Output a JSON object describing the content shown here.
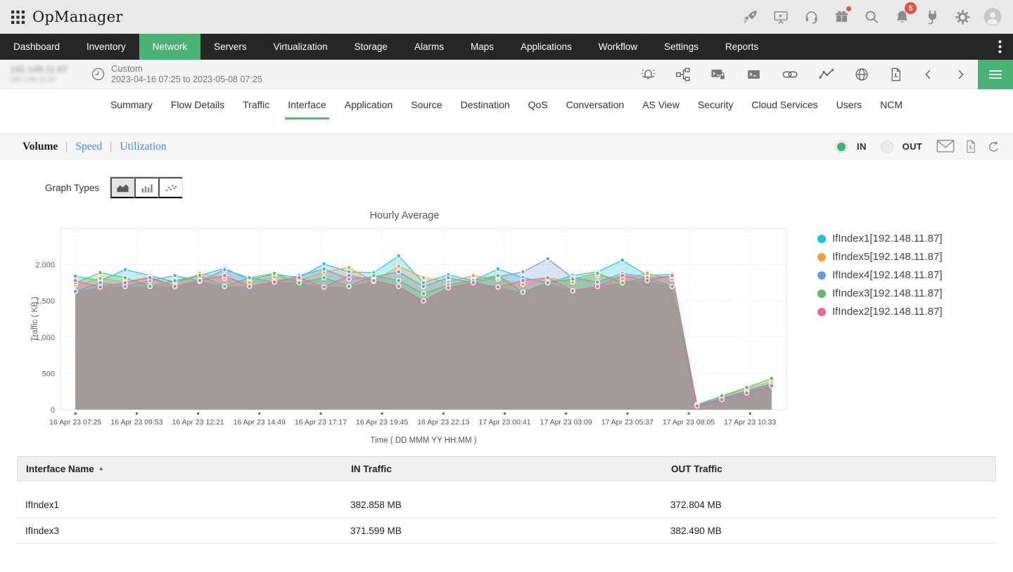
{
  "topbar": {
    "title": "OpManager",
    "icons": [
      {
        "name": "rocket-icon"
      },
      {
        "name": "demo-video-icon"
      },
      {
        "name": "support-headset-icon"
      },
      {
        "name": "whats-new-gift-icon",
        "dot": true
      },
      {
        "name": "search-icon"
      },
      {
        "name": "notifications-bell-icon",
        "badge": "5"
      },
      {
        "name": "integrations-plug-icon"
      },
      {
        "name": "settings-gear-icon"
      },
      {
        "name": "user-avatar"
      }
    ]
  },
  "nav": {
    "items": [
      {
        "label": "Dashboard",
        "active": false
      },
      {
        "label": "Inventory",
        "active": false
      },
      {
        "label": "Network",
        "active": true
      },
      {
        "label": "Servers",
        "active": false
      },
      {
        "label": "Virtualization",
        "active": false
      },
      {
        "label": "Storage",
        "active": false
      },
      {
        "label": "Alarms",
        "active": false
      },
      {
        "label": "Maps",
        "active": false
      },
      {
        "label": "Applications",
        "active": false
      },
      {
        "label": "Workflow",
        "active": false
      },
      {
        "label": "Settings",
        "active": false
      },
      {
        "label": "Reports",
        "active": false
      }
    ]
  },
  "subheader": {
    "device_name": "192.148.11.87",
    "device_name_line2": "192.148.11.87",
    "period_label": "Custom",
    "period_range": "2023-04-16 07:25 to 2023-05-08 07:25",
    "icons": [
      {
        "name": "alarm-notification-icon"
      },
      {
        "name": "discovery-topology-icon"
      },
      {
        "name": "secure-terminal-icon"
      },
      {
        "name": "terminal-icon"
      },
      {
        "name": "interface-link-icon"
      },
      {
        "name": "performance-graph-icon"
      },
      {
        "name": "web-globe-icon"
      },
      {
        "name": "pdf-report-icon"
      },
      {
        "name": "chevron-left-icon"
      },
      {
        "name": "chevron-right-icon"
      }
    ]
  },
  "tabs": [
    {
      "label": "Summary",
      "active": false
    },
    {
      "label": "Flow Details",
      "active": false
    },
    {
      "label": "Traffic",
      "active": false
    },
    {
      "label": "Interface",
      "active": true
    },
    {
      "label": "Application",
      "active": false
    },
    {
      "label": "Source",
      "active": false
    },
    {
      "label": "Destination",
      "active": false
    },
    {
      "label": "QoS",
      "active": false
    },
    {
      "label": "Conversation",
      "active": false
    },
    {
      "label": "AS View",
      "active": false
    },
    {
      "label": "Security",
      "active": false
    },
    {
      "label": "Cloud Services",
      "active": false
    },
    {
      "label": "Users",
      "active": false
    },
    {
      "label": "NCM",
      "active": false
    }
  ],
  "toolbar": {
    "views": [
      {
        "label": "Volume",
        "active": true
      },
      {
        "label": "Speed",
        "active": false
      },
      {
        "label": "Utilization",
        "active": false
      }
    ],
    "direction_options": [
      {
        "label": "IN",
        "selected": true
      },
      {
        "label": "OUT",
        "selected": false
      }
    ],
    "icons": [
      {
        "name": "email-icon"
      },
      {
        "name": "pdf-icon"
      },
      {
        "name": "reload-icon"
      }
    ]
  },
  "graph_types": {
    "label": "Graph Types",
    "options": [
      {
        "name": "area-chart-icon",
        "selected": true
      },
      {
        "name": "bar-chart-icon",
        "selected": false
      },
      {
        "name": "scatter-chart-icon",
        "selected": false
      }
    ]
  },
  "chart_data": {
    "type": "area",
    "title": "Hourly Average",
    "xlabel": "Time ( DD MMM YY HH:MM )",
    "ylabel": "Traffic ( KB )",
    "ylim": [
      0,
      2500
    ],
    "yticks": [
      0,
      500,
      1000,
      1500,
      2000
    ],
    "ytick_labels": [
      "0",
      "500",
      "1,000",
      "1,500",
      "2,000"
    ],
    "xtick_labels": [
      "16 Apr 23 07:25",
      "16 Apr 23 09:53",
      "16 Apr 23 12:21",
      "16 Apr 23 14:49",
      "16 Apr 23 17:17",
      "16 Apr 23 19:45",
      "16 Apr 23 22:13",
      "17 Apr 23 00:41",
      "17 Apr 23 03:09",
      "17 Apr 23 05:37",
      "17 Apr 23 08:05",
      "17 Apr 23 10:33"
    ],
    "xtick_interval_hours": 2.4667,
    "x_unit": "hours since 16 Apr 23 07:25",
    "grid": true,
    "legend_position": "right",
    "series": [
      {
        "name": "IfIndex1[192.148.11.87]",
        "color": "#1ec3dc",
        "values": [
          1840,
          1780,
          1930,
          1850,
          1760,
          1850,
          1950,
          1790,
          1870,
          1820,
          2010,
          1900,
          1890,
          2120,
          1750,
          1860,
          1780,
          1940,
          1820,
          1750,
          1850,
          1900,
          2060,
          1850,
          1870,
          60,
          160,
          260,
          360
        ]
      },
      {
        "name": "IfIndex5[192.148.11.87]",
        "color": "#f5a040",
        "values": [
          1720,
          1810,
          1760,
          1830,
          1700,
          1880,
          1810,
          1750,
          1830,
          1780,
          1900,
          1960,
          1770,
          1980,
          1820,
          1760,
          1850,
          1800,
          1730,
          1820,
          1760,
          1850,
          1800,
          1880,
          1800,
          70,
          180,
          285,
          390
        ]
      },
      {
        "name": "IfIndex4[192.148.11.87]",
        "color": "#6b9fd8",
        "values": [
          1630,
          1750,
          1700,
          1780,
          1850,
          1770,
          1930,
          1820,
          1760,
          1850,
          1940,
          1800,
          1830,
          1900,
          1700,
          1820,
          1750,
          1830,
          1900,
          2080,
          1820,
          1760,
          1880,
          1820,
          1840,
          55,
          150,
          250,
          355
        ]
      },
      {
        "name": "IfIndex3[192.148.11.87]",
        "color": "#5fba6b",
        "values": [
          1750,
          1890,
          1820,
          1700,
          1780,
          1850,
          1700,
          1820,
          1880,
          1750,
          1820,
          1700,
          1850,
          1780,
          1600,
          1720,
          1780,
          1850,
          1620,
          1750,
          1800,
          1880,
          1750,
          1820,
          1700,
          65,
          190,
          305,
          430
        ]
      },
      {
        "name": "IfIndex2[192.148.11.87]",
        "color": "#f0649e",
        "values": [
          1780,
          1690,
          1750,
          1820,
          1700,
          1780,
          1850,
          1700,
          1760,
          1820,
          1690,
          1850,
          1780,
          1700,
          1500,
          1680,
          1750,
          1690,
          1780,
          1820,
          1640,
          1700,
          1850,
          1780,
          1850,
          50,
          140,
          230,
          330
        ]
      }
    ]
  },
  "table": {
    "columns": [
      {
        "label": "Interface Name",
        "sorted": "asc"
      },
      {
        "label": "IN Traffic",
        "sorted": null
      },
      {
        "label": "OUT Traffic",
        "sorted": null
      }
    ],
    "rows": [
      [
        "IfIndex1",
        "382.858 MB",
        "372.804 MB"
      ],
      [
        "IfIndex3",
        "371.599 MB",
        "382.490 MB"
      ]
    ]
  },
  "colors": {
    "accent_green": "#4cb176",
    "nav_dark": "#262626",
    "link_blue": "#3d8fd8",
    "badge_red": "#e8504a",
    "area_gray": "#b7b5b1"
  }
}
